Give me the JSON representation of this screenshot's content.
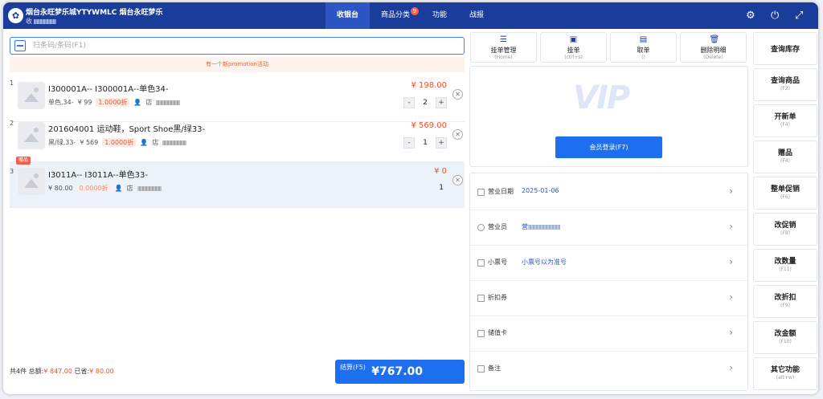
{
  "header": {
    "store_name": "烟台永旺梦乐城YTYWMLC 烟台永旺梦乐",
    "store_sub": "收",
    "tabs": [
      {
        "label": "收银台",
        "active": true
      },
      {
        "label": "商品分类",
        "badge": "9"
      },
      {
        "label": "功能"
      },
      {
        "label": "战报"
      }
    ],
    "icons": [
      "gear-icon",
      "power-icon",
      "expand-icon"
    ]
  },
  "search": {
    "placeholder": "扫条码/条码(F1)"
  },
  "promo_text": "有一个新promotion活动",
  "cart_items": [
    {
      "index": "1",
      "name": "I300001A--   I300001A--单色34-",
      "spec": "单色,34-",
      "unit_price": "¥ 99",
      "discount": "1.0000折",
      "seller_prefix": "店",
      "price": "¥ 198.00",
      "qty": "2",
      "qty_minus": "-",
      "qty_plus": "+",
      "remove": "✕"
    },
    {
      "index": "2",
      "name": "201604001   运动鞋，Sport Shoe黑/绿33-",
      "spec": "黑/绿,33-",
      "unit_price": "¥ 569",
      "discount": "1.0000折",
      "seller_prefix": "店",
      "price": "¥ 569.00",
      "qty": "1",
      "qty_minus": "-",
      "qty_plus": "+",
      "remove": "✕"
    },
    {
      "index": "3",
      "badge": "赠品",
      "name": "I3011A--   I3011A--单色33-",
      "spec": "",
      "unit_price": "¥ 80.00",
      "discount": "0.0000折",
      "seller_prefix": "店",
      "price": "¥ 0",
      "qty": "1",
      "remove": "✕"
    }
  ],
  "footer": {
    "count_prefix": "共4件",
    "total_label": "总额:",
    "total_value": "¥ 847.00",
    "discount_label": "已省:",
    "discount_value": "¥ 80.00",
    "checkout_key": "结算(F5)",
    "checkout_amount": "¥767.00"
  },
  "actions": [
    {
      "label": "挂单管理",
      "hint": "(Home)",
      "icon": "list-icon"
    },
    {
      "label": "挂单",
      "hint": "(ctrl+s)",
      "icon": "save-icon"
    },
    {
      "label": "取单",
      "hint": "()",
      "icon": "retrieve-icon"
    },
    {
      "label": "删除明细",
      "hint": "(Delete)",
      "icon": "trash-icon"
    }
  ],
  "member": {
    "logo_text": "VIP",
    "login_button": "会员登录(F7)"
  },
  "info_rows": [
    {
      "label": "营业日期",
      "value": "2025-01-06",
      "icon": "calendar-icon"
    },
    {
      "label": "营业员",
      "value": "营",
      "masked": true,
      "icon": "person-icon"
    },
    {
      "label": "小票号",
      "value": "小票号以为准号",
      "icon": "receipt-icon"
    },
    {
      "label": "折扣券",
      "value": "",
      "icon": "coupon-icon"
    },
    {
      "label": "储值卡",
      "value": "",
      "icon": "card-icon"
    },
    {
      "label": "备注",
      "value": "",
      "icon": "note-icon"
    }
  ],
  "sidebar": [
    {
      "label": "查询库存",
      "hint": ""
    },
    {
      "label": "查询商品",
      "hint": "(F2)"
    },
    {
      "label": "开新单",
      "hint": "(F4)"
    },
    {
      "label": "赠品",
      "hint": "(F4)"
    },
    {
      "label": "整单促销",
      "hint": "(F6)"
    },
    {
      "label": "改促销",
      "hint": "(F8)"
    },
    {
      "label": "改数量",
      "hint": "(F11)"
    },
    {
      "label": "改折扣",
      "hint": "(F9)"
    },
    {
      "label": "改金额",
      "hint": "(F10)"
    },
    {
      "label": "其它功能",
      "hint": "(alt+w)"
    }
  ],
  "colors": {
    "header_bg": "#1a3d9c",
    "active_tab": "#2d55c4",
    "accent": "#1e6ff0",
    "price_red": "#e8532f"
  }
}
